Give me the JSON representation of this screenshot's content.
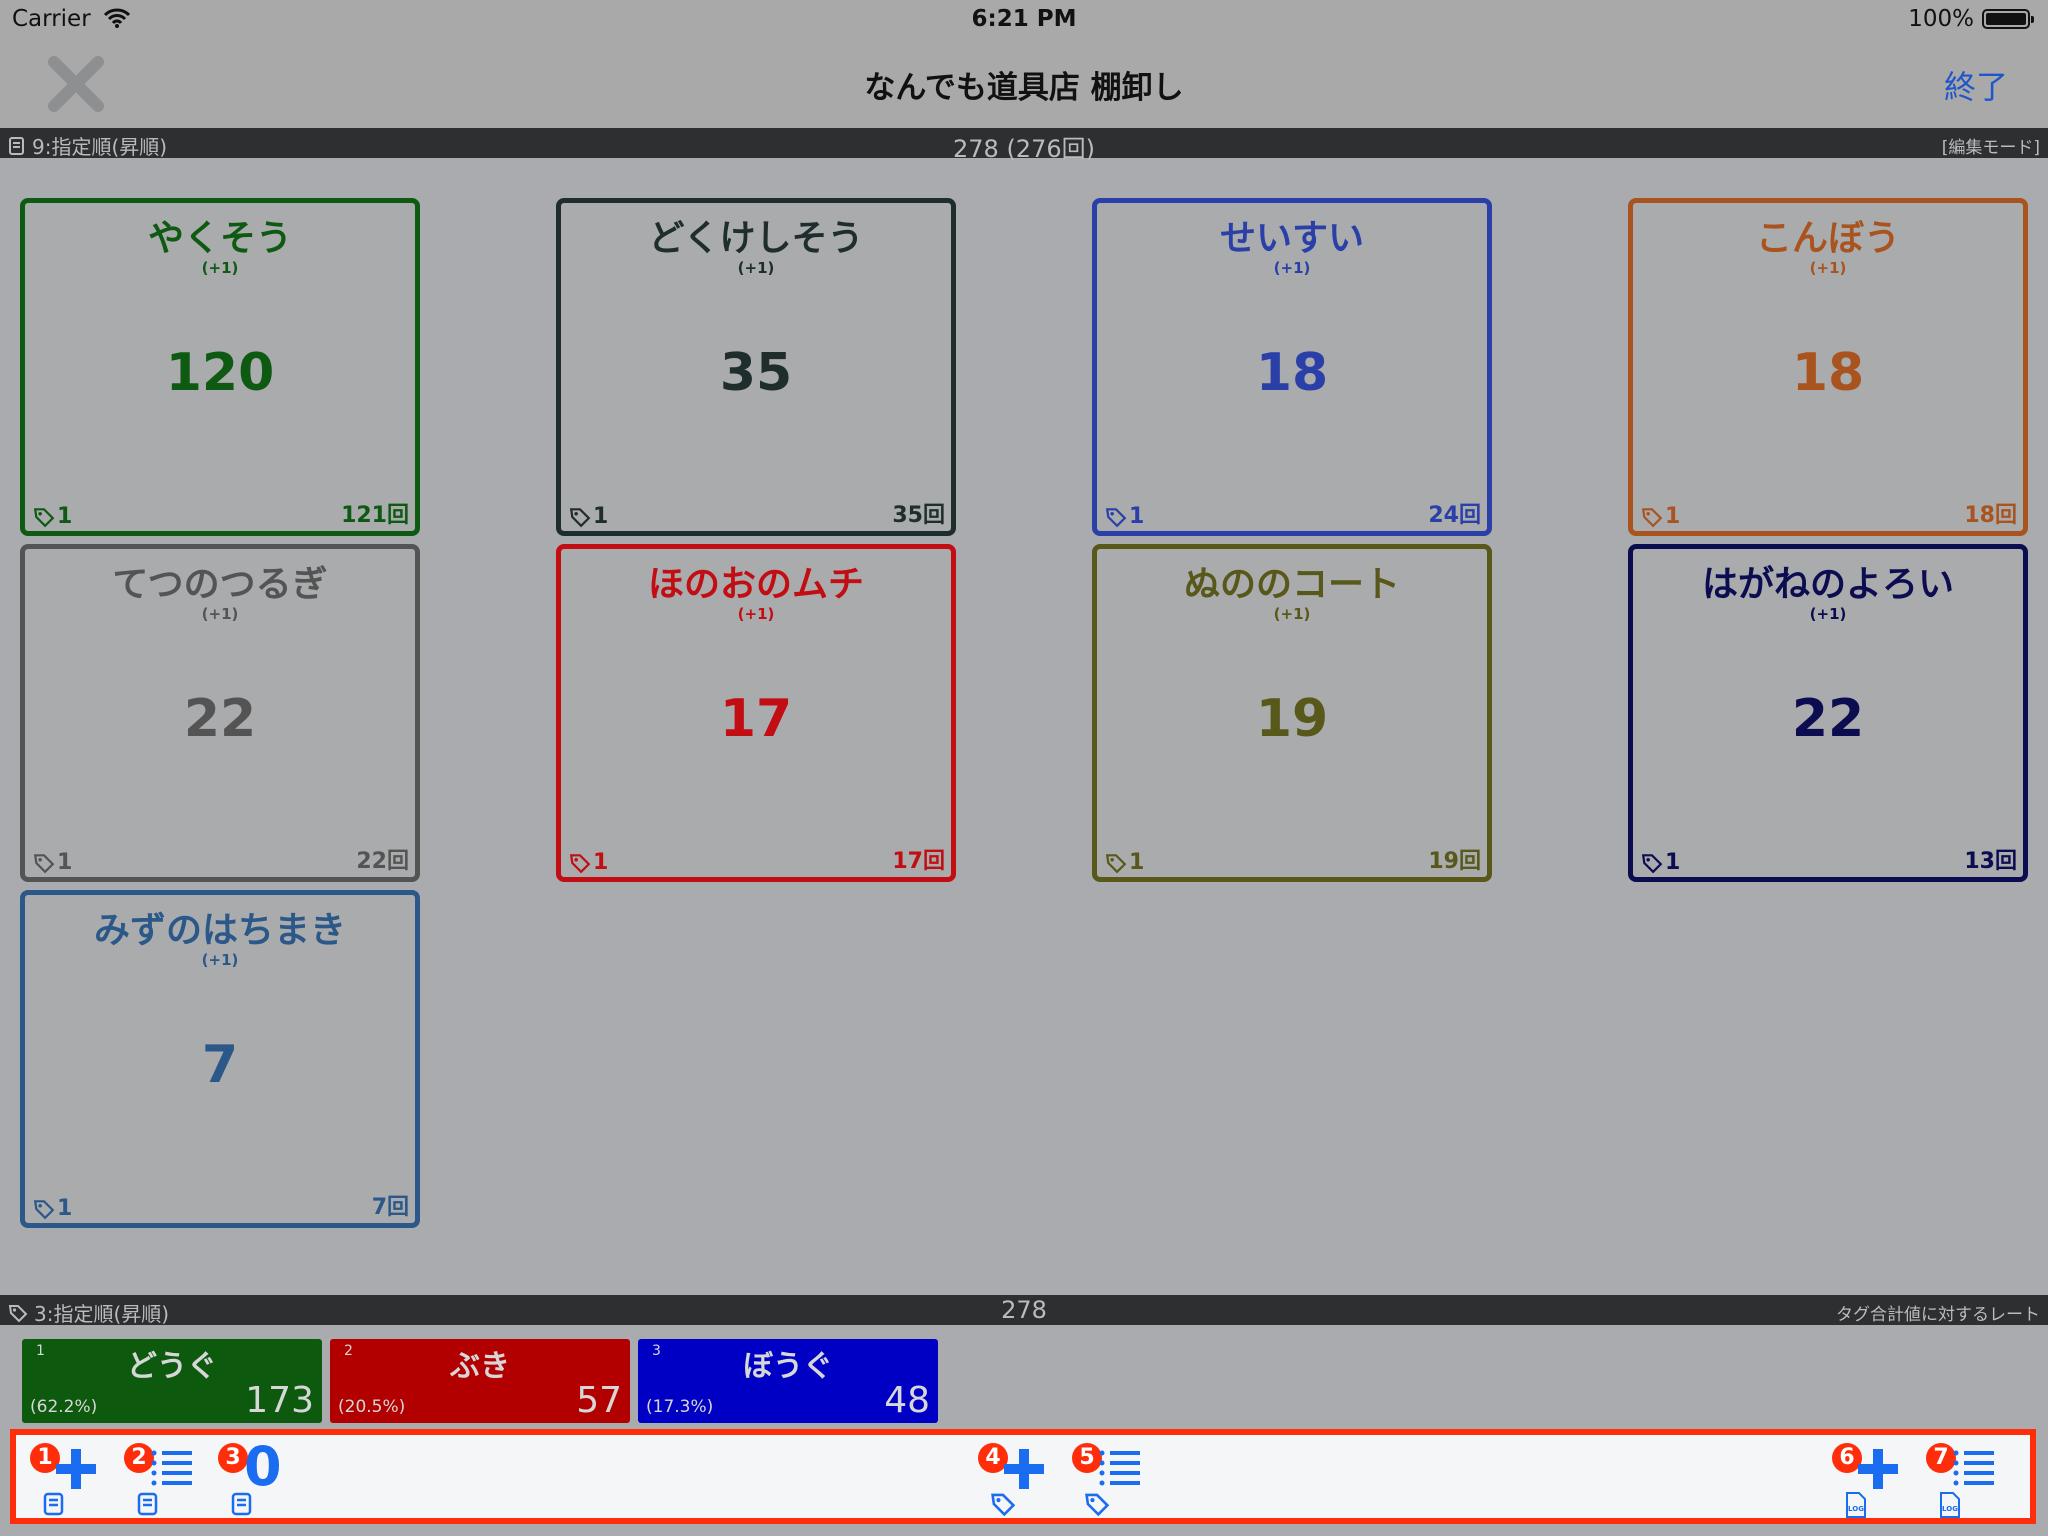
{
  "status_bar": {
    "carrier": "Carrier",
    "time": "6:21 PM",
    "battery": "100%"
  },
  "nav": {
    "title": "なんでも道具店 棚卸し",
    "done_label": "終了"
  },
  "items_header": {
    "left": "9:指定順(昇順)",
    "center": "278 (276回)",
    "right": "[編集モード]"
  },
  "items": [
    {
      "name": "やくそう",
      "inc": "(+1)",
      "value": "120",
      "tag": "1",
      "count": "121回",
      "color": "#0e5a12"
    },
    {
      "name": "どくけしそう",
      "inc": "(+1)",
      "value": "35",
      "tag": "1",
      "count": "35回",
      "color": "#1f2d2d"
    },
    {
      "name": "せいすい",
      "inc": "(+1)",
      "value": "18",
      "tag": "1",
      "count": "24回",
      "color": "#2a3fa8"
    },
    {
      "name": "こんぼう",
      "inc": "(+1)",
      "value": "18",
      "tag": "1",
      "count": "18回",
      "color": "#a9531f"
    },
    {
      "name": "てつのつるぎ",
      "inc": "(+1)",
      "value": "22",
      "tag": "1",
      "count": "22回",
      "color": "#545454"
    },
    {
      "name": "ほのおのムチ",
      "inc": "(+1)",
      "value": "17",
      "tag": "1",
      "count": "17回",
      "color": "#c20d12"
    },
    {
      "name": "ぬののコート",
      "inc": "(+1)",
      "value": "19",
      "tag": "1",
      "count": "19回",
      "color": "#58581a"
    },
    {
      "name": "はがねのよろい",
      "inc": "(+1)",
      "value": "22",
      "tag": "1",
      "count": "13回",
      "color": "#0c0c50"
    },
    {
      "name": "みずのはちまき",
      "inc": "(+1)",
      "value": "7",
      "tag": "1",
      "count": "7回",
      "color": "#2b5888"
    }
  ],
  "tags_header": {
    "left": "3:指定順(昇順)",
    "center": "278",
    "right": "タグ合計値に対するレート"
  },
  "tags": [
    {
      "index": "1",
      "name": "どうぐ",
      "percent": "(62.2%)",
      "value": "173",
      "color": "#0d5a0f"
    },
    {
      "index": "2",
      "name": "ぶき",
      "percent": "(20.5%)",
      "value": "57",
      "color": "#b20000"
    },
    {
      "index": "3",
      "name": "ぼうぐ",
      "percent": "(17.3%)",
      "value": "48",
      "color": "#0000c4"
    }
  ],
  "toolbar": [
    {
      "num": "1",
      "icon": "add-icon",
      "sub": "book-icon"
    },
    {
      "num": "2",
      "icon": "list-icon",
      "sub": "book-icon"
    },
    {
      "num": "3",
      "icon": "zero-icon",
      "label": "0",
      "sub": "book-icon"
    },
    {
      "num": "4",
      "icon": "add-icon",
      "sub": "tag-icon"
    },
    {
      "num": "5",
      "icon": "list-icon",
      "sub": "tag-icon"
    },
    {
      "num": "6",
      "icon": "add-icon",
      "sub": "log-icon",
      "sub_label": "LOG"
    },
    {
      "num": "7",
      "icon": "list-icon",
      "sub": "log-icon",
      "sub_label": "LOG"
    }
  ],
  "colors": {
    "accent": "#1f56c9",
    "highlight": "#ff2d0a",
    "toolbar_blue": "#1a6cf0"
  }
}
